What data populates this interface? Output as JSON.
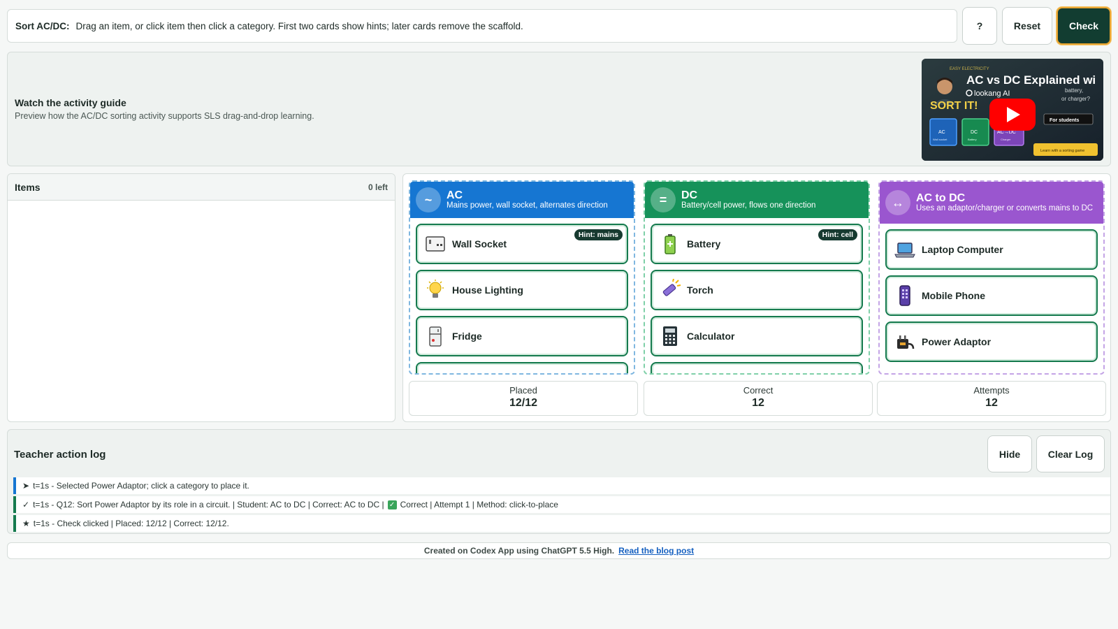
{
  "toolbar": {
    "instruction_label": "Sort AC/DC:",
    "instruction_text": "Drag an item, or click item then click a category. First two cards show hints; later cards remove the scaffold.",
    "help_label": "?",
    "reset_label": "Reset",
    "check_label": "Check"
  },
  "guide": {
    "title": "Watch the activity guide",
    "subtitle": "Preview how the AC/DC sorting activity supports SLS drag-and-drop learning.",
    "video_title": "AC vs DC Explained wi",
    "video_channel": "lookang AI",
    "video_tag": "SORT IT!",
    "video_corner": "EASY ELECTRICITY",
    "video_side_1": "battery,",
    "video_side_2": "or charger?",
    "video_students": "For students",
    "video_learn": "Learn with a sorting game",
    "video_box_ac": "AC",
    "video_box_dc": "DC",
    "video_box_acdc": "AC→DC",
    "video_box_ac_sub": "Wall socket",
    "video_box_dc_sub": "Battery",
    "video_box_acdc_sub": "Charger"
  },
  "items_panel": {
    "title": "Items",
    "count": "0 left"
  },
  "categories": [
    {
      "symbol": "~",
      "name": "AC",
      "description": "Mains power, wall socket, alternates direction",
      "cards": [
        {
          "label": "Wall Socket",
          "icon": "wall-socket-icon",
          "hint": "Hint: mains"
        },
        {
          "label": "House Lighting",
          "icon": "light-bulb-icon"
        },
        {
          "label": "Fridge",
          "icon": "fridge-icon"
        }
      ]
    },
    {
      "symbol": "=",
      "name": "DC",
      "description": "Battery/cell power, flows one direction",
      "cards": [
        {
          "label": "Battery",
          "icon": "battery-icon",
          "hint": "Hint: cell"
        },
        {
          "label": "Torch",
          "icon": "torch-icon"
        },
        {
          "label": "Calculator",
          "icon": "calculator-icon"
        }
      ]
    },
    {
      "symbol": "↔",
      "name": "AC to DC",
      "description": "Uses an adaptor/charger or converts mains to DC",
      "cards": [
        {
          "label": "Laptop Computer",
          "icon": "laptop-icon"
        },
        {
          "label": "Mobile Phone",
          "icon": "mobile-phone-icon"
        },
        {
          "label": "Power Adaptor",
          "icon": "power-adaptor-icon"
        }
      ]
    }
  ],
  "stats": {
    "placed_label": "Placed",
    "placed_value": "12/12",
    "correct_label": "Correct",
    "correct_value": "12",
    "attempts_label": "Attempts",
    "attempts_value": "12"
  },
  "log": {
    "title": "Teacher action log",
    "hide_label": "Hide",
    "clear_label": "Clear Log",
    "entries": [
      {
        "symbol": "➤",
        "text": "t=1s - Selected Power Adaptor; click a category to place it."
      },
      {
        "symbol": "✓",
        "text_before": "t=1s - Q12: Sort Power Adaptor by its role in a circuit. | Student: AC to DC | Correct: AC to DC |",
        "check": "✓",
        "text_after": "Correct | Attempt 1 | Method: click-to-place"
      },
      {
        "symbol": "★",
        "text": "t=1s - Check clicked | Placed: 12/12 | Correct: 12/12."
      }
    ]
  },
  "footer": {
    "text": "Created on Codex App using ChatGPT 5.5 High.",
    "link": "Read the blog post"
  }
}
